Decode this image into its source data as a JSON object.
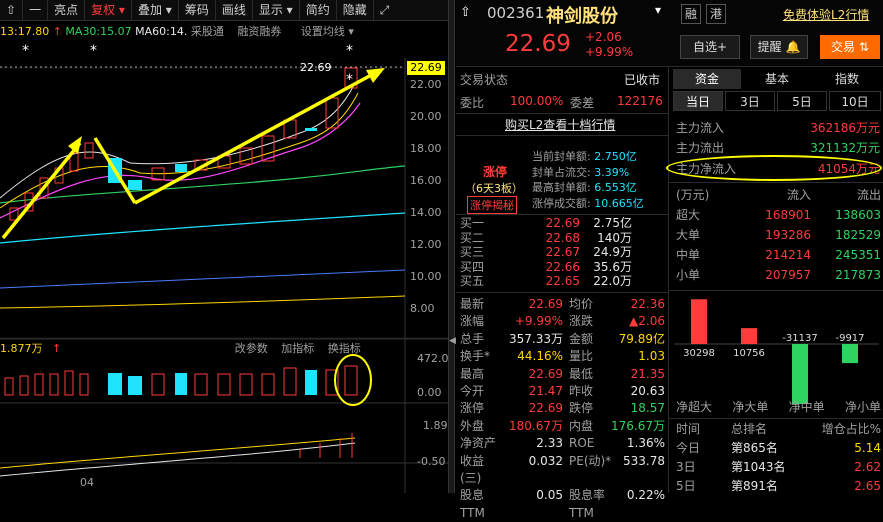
{
  "toolbar": {
    "back": "⇧",
    "minus": "一",
    "items": [
      "亮点",
      "复权",
      "叠加",
      "筹码",
      "画线",
      "显示",
      "简约",
      "隐藏"
    ],
    "expand": "⤢"
  },
  "ma": {
    "time": "13:17.80",
    "ma30": "MA30:15.07",
    "ma60": "MA60:14.",
    "tags": "采股通",
    "tag2": "融资融券",
    "tag3": "设置均线"
  },
  "price_label": "22.69",
  "dash_label": "22.69",
  "y_axis": [
    "22.00",
    "20.00",
    "18.00",
    "16.00",
    "14.00",
    "12.00",
    "10.00",
    "8.00"
  ],
  "vol": {
    "label": "1.877万",
    "p1": "改参数",
    "p2": "加指标",
    "p3": "换指标",
    "y1": "472.00",
    "y2": "0.00"
  },
  "ind": {
    "y1": "1.89",
    "y2": "-0.50"
  },
  "xaxis": {
    "d04": "04"
  },
  "stock": {
    "code": "002361",
    "name": "神剑股份",
    "rz": "融",
    "gang": "港",
    "free": "免费体验L2行情",
    "price": "22.69",
    "chg": "+2.06",
    "pct": "+9.99%",
    "zx": "自选+",
    "tx": "提醒",
    "jy": "交易"
  },
  "status": {
    "label": "交易状态",
    "value": "已收市",
    "wb": "委比",
    "wb_v": "100.00%",
    "wc": "委差",
    "wc_v": "122176",
    "buy_l2": "购买L2查看十档行情"
  },
  "limit": {
    "t1": "涨停",
    "t2": "（6天3板）",
    "t3": "涨停揭秘",
    "rows": [
      [
        "当前封单额:",
        "2.750亿"
      ],
      [
        "封单占流交:",
        "3.39%"
      ],
      [
        "最高封单额:",
        "6.553亿"
      ],
      [
        "涨停成交额:",
        "10.665亿"
      ]
    ]
  },
  "orderbook": [
    [
      "买一",
      "22.69",
      "2.75亿"
    ],
    [
      "买二",
      "22.68",
      "140万"
    ],
    [
      "买三",
      "22.67",
      "24.9万"
    ],
    [
      "买四",
      "22.66",
      "35.6万"
    ],
    [
      "买五",
      "22.65",
      "22.0万"
    ]
  ],
  "quote": [
    [
      "最新",
      "22.69",
      "均价",
      "22.36"
    ],
    [
      "涨幅",
      "+9.99%",
      "涨跌",
      "▲2.06"
    ],
    [
      "总手",
      "357.33万",
      "金额",
      "79.89亿"
    ],
    [
      "换手*",
      "44.16%",
      "量比",
      "1.03"
    ],
    [
      "最高",
      "22.69",
      "最低",
      "21.35"
    ],
    [
      "今开",
      "21.47",
      "昨收",
      "20.63"
    ],
    [
      "涨停",
      "22.69",
      "跌停",
      "18.57"
    ],
    [
      "外盘",
      "180.67万",
      "内盘",
      "176.67万"
    ],
    [
      "净资产",
      "2.33",
      "ROE",
      "1.36%"
    ],
    [
      "收益(三)",
      "0.032",
      "PE(动)*",
      "533.78"
    ],
    [
      "股息TTM",
      "0.05",
      "股息率TTM",
      "0.22%"
    ]
  ],
  "flow_tabs": [
    "资金",
    "基本",
    "指数"
  ],
  "period_tabs": [
    "当日",
    "3日",
    "5日",
    "10日"
  ],
  "flow": [
    [
      "主力流入",
      "362186万元"
    ],
    [
      "主力流出",
      "321132万元"
    ],
    [
      "主力净流入",
      "41054万元"
    ]
  ],
  "flow_head": [
    "(万元)",
    "流入",
    "流出"
  ],
  "flow_rows": [
    [
      "超大",
      "168901",
      "138603"
    ],
    [
      "大单",
      "193286",
      "182529"
    ],
    [
      "中单",
      "214214",
      "245351"
    ],
    [
      "小单",
      "207957",
      "217873"
    ]
  ],
  "bars": {
    "values": [
      30298,
      10756,
      -31137,
      -9917
    ],
    "labels": [
      "净超大",
      "净大单",
      "净中单",
      "净小单"
    ]
  },
  "rank_head": [
    "时间",
    "总排名",
    "增仓占比%"
  ],
  "rank": [
    [
      "今日",
      "第865名",
      "5.14"
    ],
    [
      "3日",
      "第1043名",
      "2.62"
    ],
    [
      "5日",
      "第891名",
      "2.65"
    ]
  ],
  "colors": {
    "up": "#ff3b3b",
    "down": "#2fd35f",
    "cyan": "#1fe4ff",
    "annot": "#ffff00"
  }
}
